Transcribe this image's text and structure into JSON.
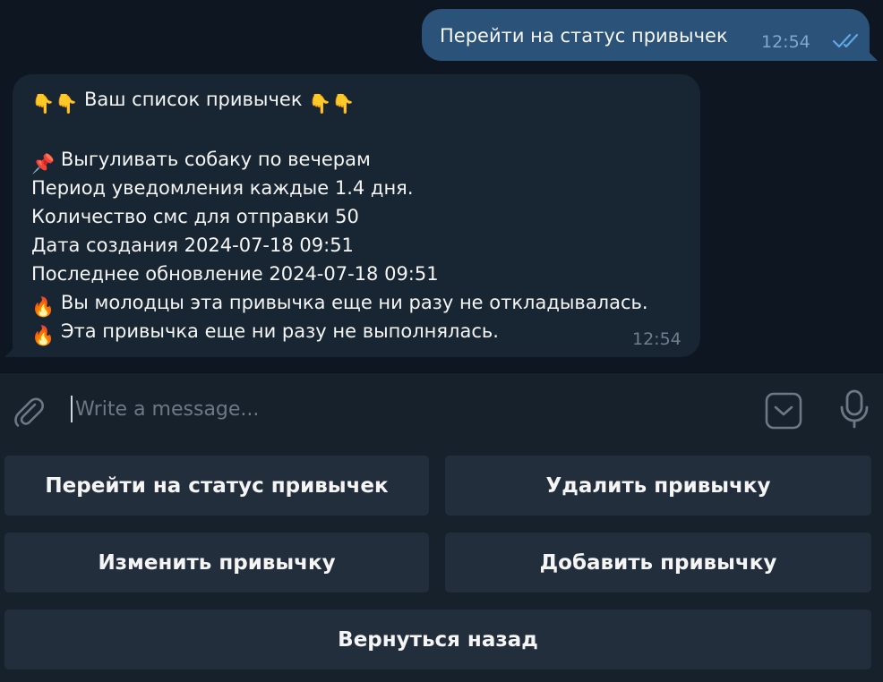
{
  "outgoing_message": {
    "text": "Перейти на статус привычек",
    "time": "12:54",
    "status_icon": "double-check-icon"
  },
  "incoming_message": {
    "header": {
      "emoji_left": "👇👇",
      "text": "Ваш список привычек",
      "emoji_right": "👇👇"
    },
    "habit": {
      "pin_emoji": "📌",
      "title": "Выгуливать собаку по вечерам",
      "period": "Период уведомления каждые 1.4 дня.",
      "sms_count": "Количество смс для отправки 50",
      "created": "Дата создания 2024-07-18 09:51",
      "updated": "Последнее обновление 2024-07-18 09:51",
      "fire_emoji": "🔥",
      "postponed_note": "Вы молодцы эта привычка еще ни разу не откладывалась.",
      "completed_note": "Эта привычка еще ни разу не выполнялась."
    },
    "time": "12:54"
  },
  "composer": {
    "placeholder": "Write a message..."
  },
  "keyboard": {
    "buttons": [
      "Перейти на статус привычек",
      "Удалить привычку",
      "Изменить привычку",
      "Добавить привычку",
      "Вернуться назад"
    ]
  },
  "colors": {
    "background": "#0e1621",
    "outgoing_bubble": "#2b5278",
    "incoming_bubble": "#182533",
    "panel": "#17212b",
    "button": "#232e3c",
    "read_check": "#5fa8e6"
  }
}
